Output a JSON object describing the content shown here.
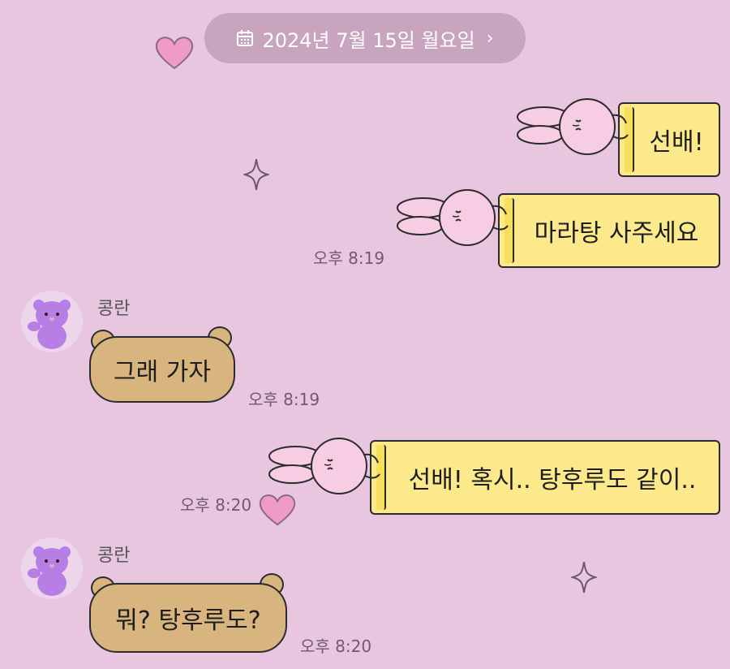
{
  "header": {
    "date_label": "2024년 7월 15일 월요일",
    "chevron": "›"
  },
  "messages": {
    "m1": {
      "text": "선배!"
    },
    "m2": {
      "text": "마라탕 사주세요",
      "time": "오후 8:19"
    },
    "m3": {
      "sender": "콩란",
      "text": "그래 가자",
      "time": "오후 8:19"
    },
    "m4": {
      "text": "선배! 혹시.. 탕후루도 같이..",
      "time": "오후 8:20"
    },
    "m5": {
      "sender": "콩란",
      "text": "뭐? 탕후루도?",
      "time": "오후 8:20"
    }
  },
  "icons": {
    "calendar": "calendar-icon",
    "heart": "heart-icon",
    "sparkle": "sparkle-icon",
    "bunny": "bunny-sticker",
    "bear": "bear-avatar"
  },
  "colors": {
    "background": "#e8c6e0",
    "pill": "#c8a4bf",
    "outgoing_bubble": "#fbe98c",
    "incoming_bubble": "#d8b47e",
    "heart": "#f09ac8"
  }
}
